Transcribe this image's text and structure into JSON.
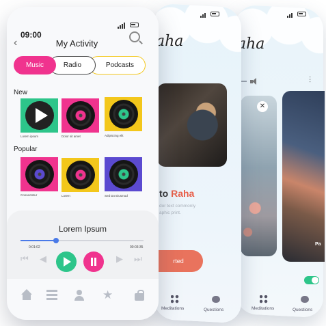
{
  "front": {
    "status": {
      "time": "09:00"
    },
    "header": {
      "title": "My Activity",
      "back_icon": "chevron-left-icon",
      "search_icon": "search-icon"
    },
    "tabs": [
      {
        "label": "Music",
        "active": true
      },
      {
        "label": "Radio",
        "active": false
      },
      {
        "label": "Podcasts",
        "active": false
      }
    ],
    "sections": {
      "new": {
        "label": "New",
        "items": [
          {
            "caption": "Lorem ipsum",
            "color": "#2dc58a",
            "icon": "play-icon"
          },
          {
            "caption": "Dolor sit amet",
            "color": "#f0338e",
            "icon": "vinyl-icon"
          },
          {
            "caption": "Adipiscing elit",
            "color": "#f3c71b",
            "icon": "vinyl-icon"
          }
        ]
      },
      "popular": {
        "label": "Popular",
        "items": [
          {
            "caption": "Consectetur",
            "color": "#f0338e",
            "icon": "vinyl-icon"
          },
          {
            "caption": "Lorem",
            "color": "#f3c71b",
            "icon": "vinyl-icon"
          },
          {
            "caption": "Sed Do Eiusmod",
            "color": "#5b4ad0",
            "icon": "vinyl-icon"
          }
        ]
      }
    },
    "player": {
      "song_title": "Lorem Ipsum",
      "elapsed": "0:01:02",
      "duration": "00:03:35",
      "progress": 0.29,
      "accent_color": "#4a7ae8",
      "play_color": "#2dc58a",
      "pause_color": "#f0338e"
    },
    "bottom_nav": [
      "home-icon",
      "list-icon",
      "user-icon",
      "star-icon",
      "bag-icon"
    ]
  },
  "back1": {
    "logo": "aha",
    "heading_prefix": "to",
    "heading_accent": "Raha",
    "paragraph_line1": "dor text commonly",
    "paragraph_line2": "aphic print.",
    "button_label": "rted",
    "nav": [
      {
        "label": "Meditations",
        "icon": "grid-icon"
      },
      {
        "label": "Questions",
        "icon": "chat-icon"
      }
    ]
  },
  "back2": {
    "logo": "aha",
    "card_label": "Pa",
    "nav": [
      {
        "label": "Meditations",
        "icon": "grid-icon"
      },
      {
        "label": "Questions",
        "icon": "chat-icon"
      }
    ]
  }
}
